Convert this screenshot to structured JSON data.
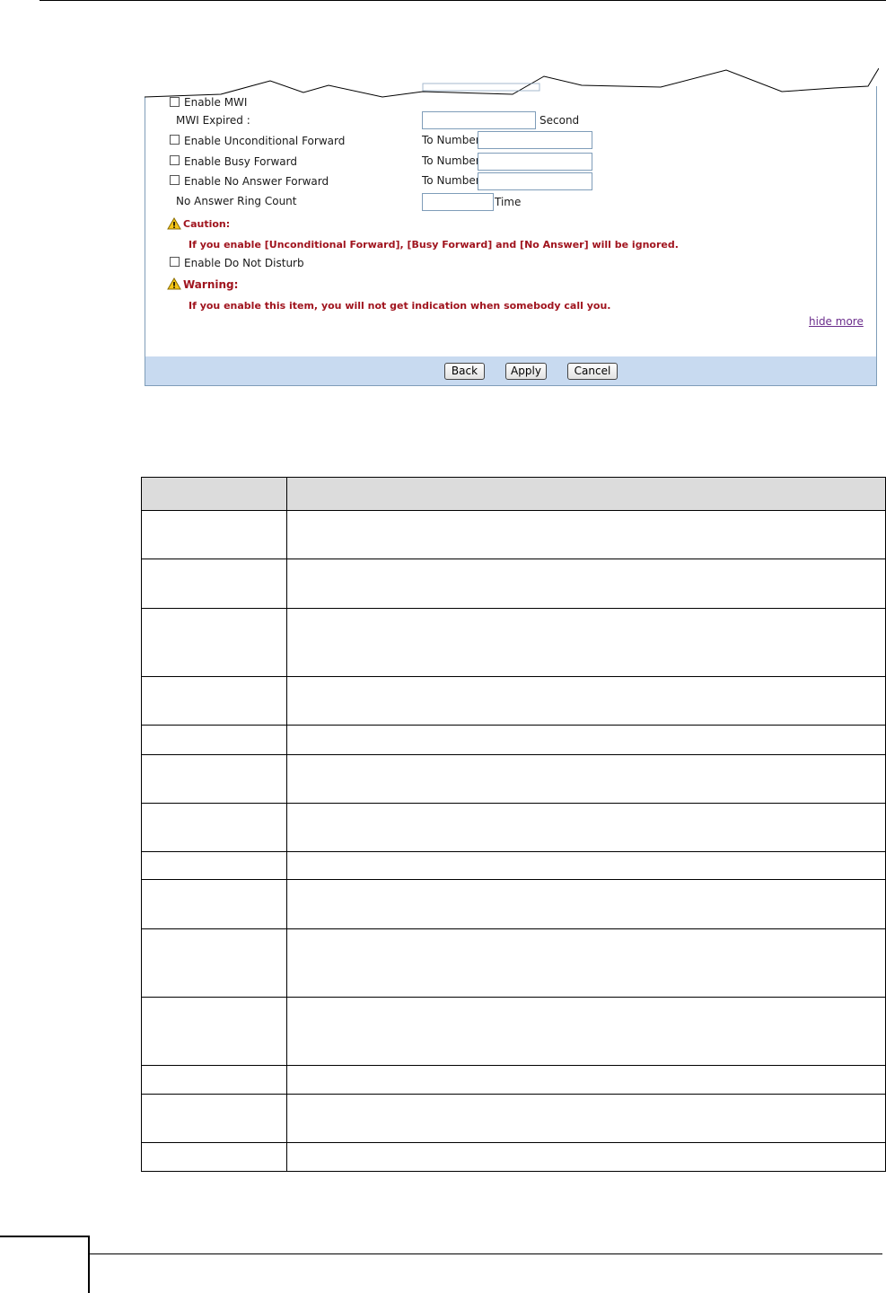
{
  "form": {
    "enable_mwi": "Enable MWI",
    "mwi_expired": "MWI Expired :",
    "second_unit": "Second",
    "enable_unconditional_forward": "Enable Unconditional Forward",
    "enable_busy_forward": "Enable Busy Forward",
    "enable_no_answer_forward": "Enable No Answer Forward",
    "to_number": "To Number:",
    "no_answer_ring_count": "No Answer Ring Count",
    "time_unit": "Time",
    "caution_title": "Caution:",
    "caution_text": "If you enable [Unconditional Forward], [Busy Forward] and [No Answer] will be ignored.",
    "enable_do_not_disturb": "Enable Do Not Disturb",
    "warning_title": "Warning:",
    "warning_text": "If you enable this item, you will not get indication when somebody call you.",
    "hide_more": "hide more",
    "values": {
      "mwi_expired": "",
      "unconditional_to": "",
      "busy_to": "",
      "no_answer_to": "",
      "ring_count": ""
    },
    "checked": {
      "enable_mwi": false,
      "unconditional_forward": false,
      "busy_forward": false,
      "no_answer_forward": false,
      "do_not_disturb": false
    }
  },
  "buttons": {
    "back": "Back",
    "apply": "Apply",
    "cancel": "Cancel"
  },
  "colors": {
    "caution_text": "#a0141e",
    "footer_bar": "#c8daf0",
    "link": "#6b2d8c",
    "table_header": "#dcdcdc"
  }
}
